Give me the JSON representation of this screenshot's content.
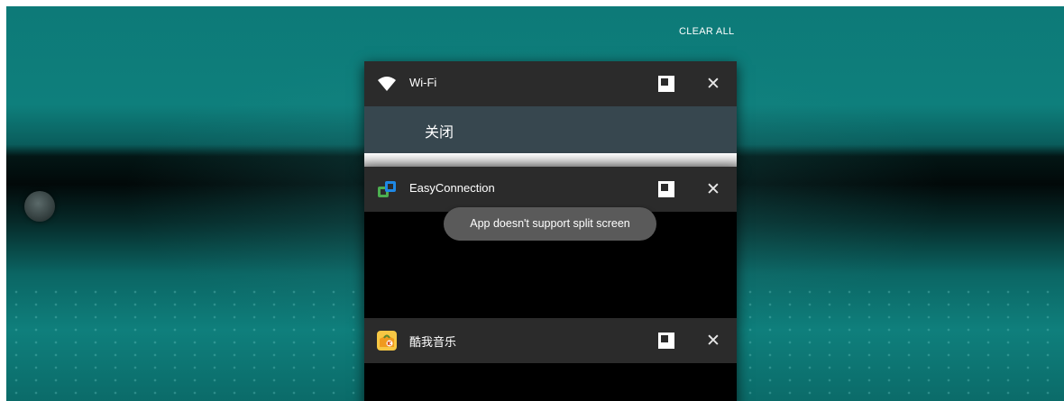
{
  "recents": {
    "clear_all_label": "CLEAR ALL",
    "cards": [
      {
        "app_name": "Wi-Fi",
        "icon": "wifi-icon",
        "status_text": "关闭"
      },
      {
        "app_name": "EasyConnection",
        "icon": "easyconnection-app-icon"
      },
      {
        "app_name": "酷我音乐",
        "icon": "kuwo-music-app-icon"
      }
    ],
    "toast_message": "App doesn't support split screen"
  },
  "colors": {
    "card_header": "#2b2b2b",
    "wifi_body": "#37474f",
    "toast": "#5a5a5a",
    "accent_green": "#4caf50",
    "accent_blue": "#1e88e5"
  }
}
